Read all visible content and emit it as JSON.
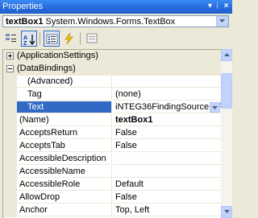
{
  "window": {
    "title": "Properties",
    "pin_glyph": "↓X"
  },
  "selector": {
    "object_name": "textBox1",
    "object_type": " System.Windows.Forms.TextBox"
  },
  "toolbar": {
    "categorized": "categorized-icon",
    "alphabetical": "alphabetical-icon",
    "properties": "properties-icon",
    "events": "events-icon",
    "property_pages": "property-pages-icon"
  },
  "rows": [
    {
      "kind": "category",
      "expander": "+",
      "name": "(ApplicationSettings)"
    },
    {
      "kind": "category",
      "expander": "-",
      "name": "(DataBindings)"
    },
    {
      "kind": "sub",
      "name": "(Advanced)",
      "value": ""
    },
    {
      "kind": "sub",
      "name": "Tag",
      "value": "(none)"
    },
    {
      "kind": "sub",
      "name": "Text",
      "value": "iNTEG36FindingSource - PR",
      "selected": true
    },
    {
      "kind": "prop",
      "name": "(Name)",
      "value": "textBox1",
      "bold": true
    },
    {
      "kind": "prop",
      "name": "AcceptsReturn",
      "value": "False"
    },
    {
      "kind": "prop",
      "name": "AcceptsTab",
      "value": "False"
    },
    {
      "kind": "prop",
      "name": "AccessibleDescription",
      "value": ""
    },
    {
      "kind": "prop",
      "name": "AccessibleName",
      "value": ""
    },
    {
      "kind": "prop",
      "name": "AccessibleRole",
      "value": "Default"
    },
    {
      "kind": "prop",
      "name": "AllowDrop",
      "value": "False"
    },
    {
      "kind": "prop",
      "name": "Anchor",
      "value": "Top, Left"
    }
  ]
}
